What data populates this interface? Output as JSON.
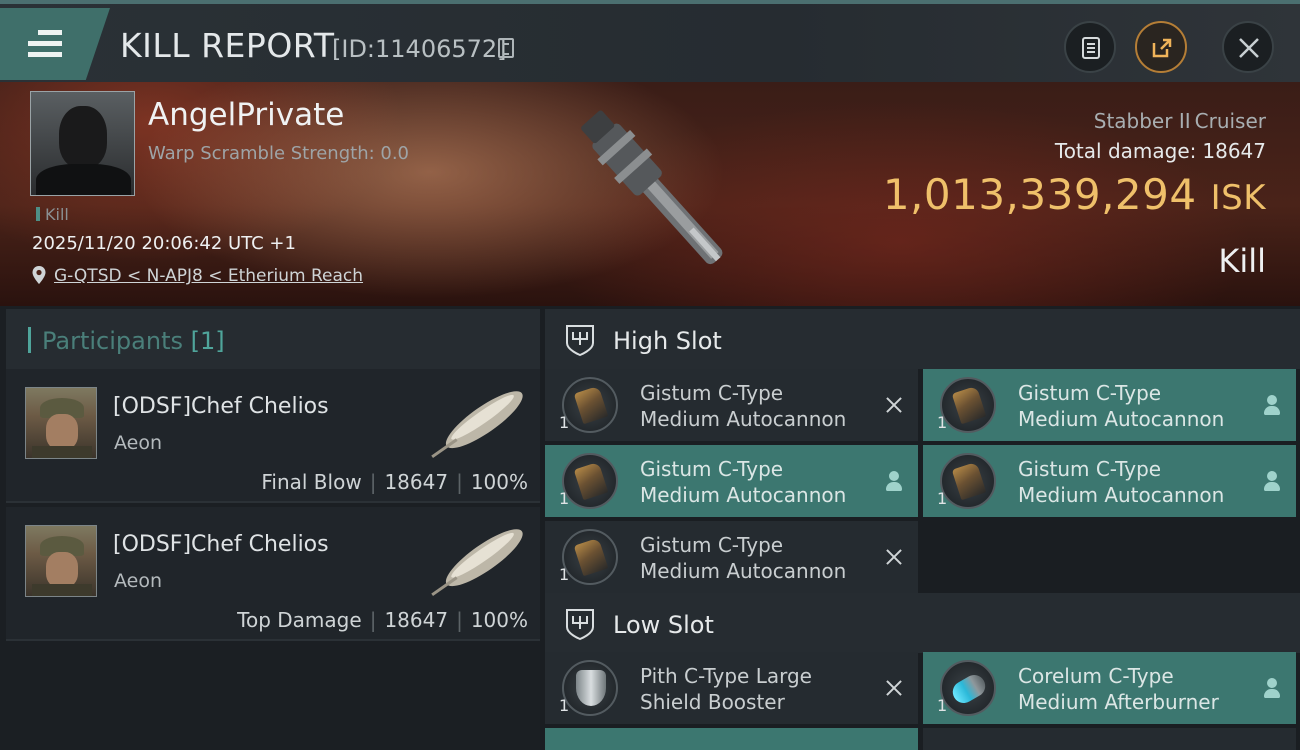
{
  "header": {
    "title": "KILL REPORT",
    "report_id": "[ID:11406572]"
  },
  "victim": {
    "name": "AngelPrivate",
    "warp_scramble": "Warp Scramble Strength: 0.0",
    "tag": "Kill",
    "timestamp": "2025/11/20 20:06:42 UTC +1",
    "location": "G-QTSD < N-APJ8 < Etherium Reach",
    "ship_name": "Stabber II",
    "ship_class": "Cruiser",
    "total_damage_label": "Total damage:",
    "total_damage": "18647",
    "isk_value": "1,013,339,294",
    "isk_unit": "ISK",
    "result": "Kill"
  },
  "participants": {
    "label": "Participants",
    "count": "[1]",
    "items": [
      {
        "name": "[ODSF]Chef Chelios",
        "ship": "Aeon",
        "role": "Final Blow",
        "damage": "18647",
        "percent": "100%"
      },
      {
        "name": "[ODSF]Chef Chelios",
        "ship": "Aeon",
        "role": "Top Damage",
        "damage": "18647",
        "percent": "100%"
      }
    ]
  },
  "fitting": {
    "high_slot_label": "High Slot",
    "low_slot_label": "Low Slot",
    "high": [
      {
        "line1": "Gistum C-Type",
        "line2": "Medium Autocannon",
        "qty": "1",
        "status": "destroyed",
        "icon": "autocannon-icon"
      },
      {
        "line1": "Gistum C-Type",
        "line2": "Medium Autocannon",
        "qty": "1",
        "status": "dropped",
        "icon": "autocannon-icon"
      },
      {
        "line1": "Gistum C-Type",
        "line2": "Medium Autocannon",
        "qty": "1",
        "status": "dropped",
        "icon": "autocannon-icon"
      },
      {
        "line1": "Gistum C-Type",
        "line2": "Medium Autocannon",
        "qty": "1",
        "status": "dropped",
        "icon": "autocannon-icon"
      },
      {
        "line1": "Gistum C-Type",
        "line2": "Medium Autocannon",
        "qty": "1",
        "status": "destroyed",
        "icon": "autocannon-icon"
      }
    ],
    "low": [
      {
        "line1": "Pith C-Type Large",
        "line2": "Shield Booster",
        "qty": "1",
        "status": "destroyed",
        "icon": "shield-booster-icon"
      },
      {
        "line1": "Corelum C-Type",
        "line2": "Medium Afterburner",
        "qty": "1",
        "status": "dropped",
        "icon": "afterburner-icon"
      }
    ]
  },
  "colors": {
    "accent_teal": "#3c7770",
    "isk_gold": "#efc06a",
    "panel": "#252b30"
  }
}
